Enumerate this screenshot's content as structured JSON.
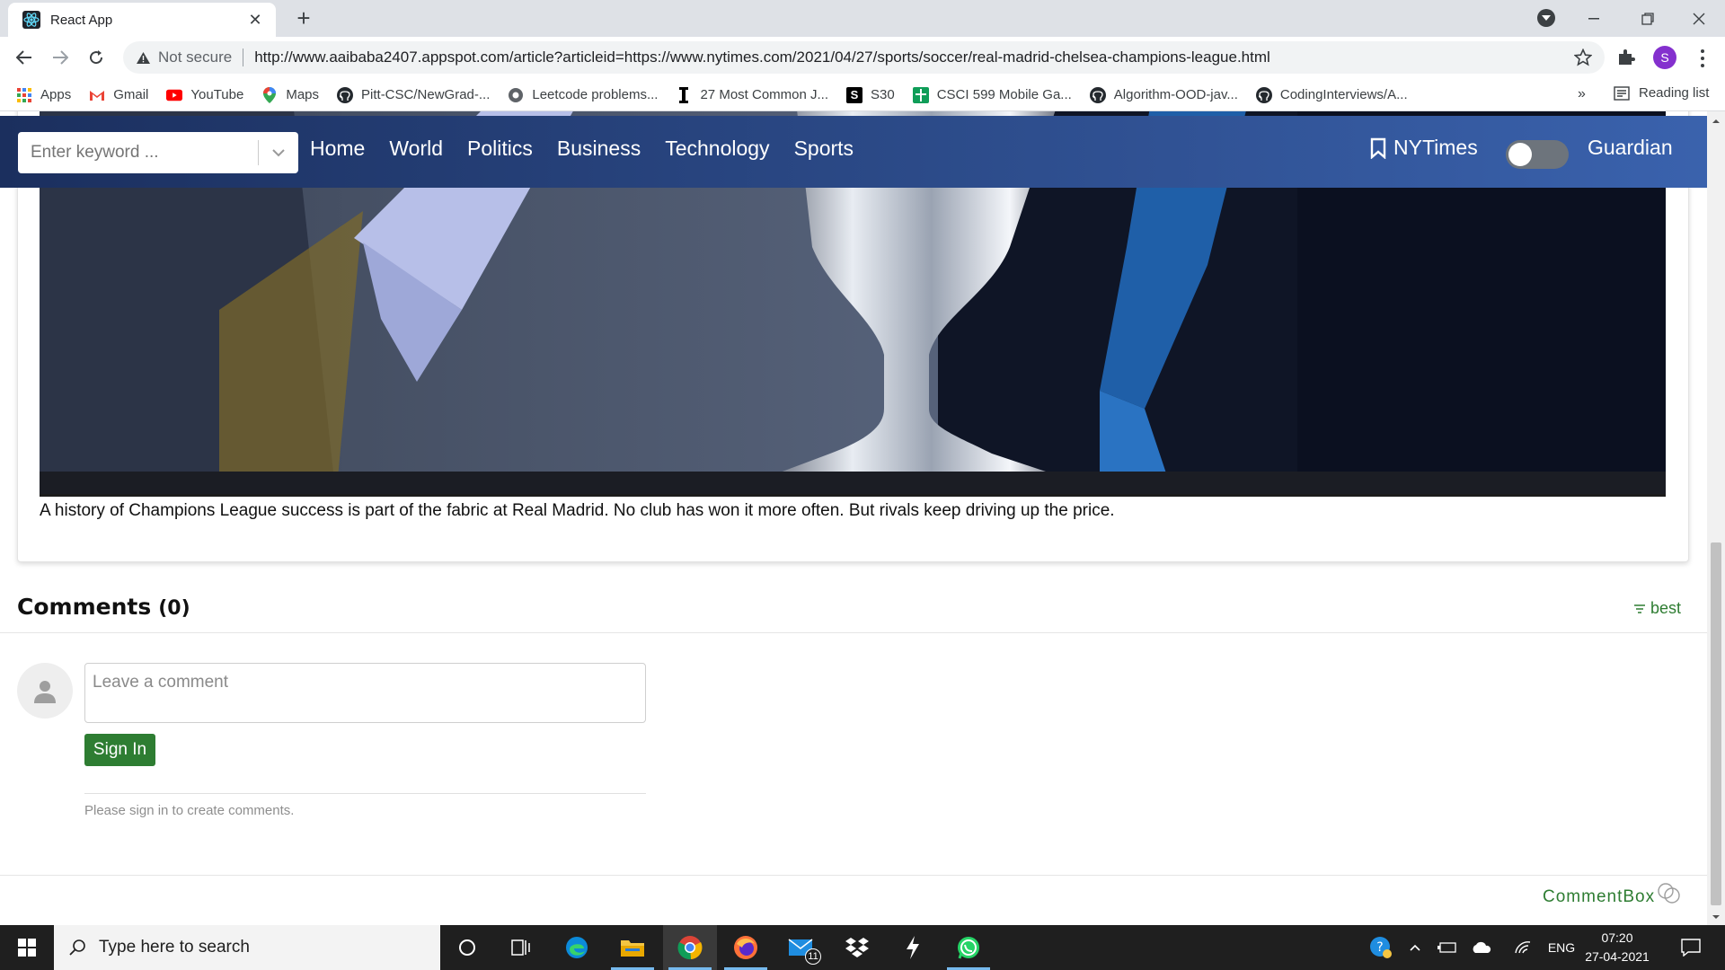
{
  "browser": {
    "tab_title": "React App",
    "security_label": "Not secure",
    "url": "http://www.aaibaba2407.appspot.com/article?articleid=https://www.nytimes.com/2021/04/27/sports/soccer/real-madrid-chelsea-champions-league.html",
    "profile_initial": "S",
    "bookmarks": [
      {
        "label": "Apps",
        "icon": "apps-grid-icon"
      },
      {
        "label": "Gmail",
        "icon": "gmail-icon"
      },
      {
        "label": "YouTube",
        "icon": "youtube-icon"
      },
      {
        "label": "Maps",
        "icon": "maps-icon"
      },
      {
        "label": "Pitt-CSC/NewGrad-...",
        "icon": "github-icon"
      },
      {
        "label": "Leetcode problems...",
        "icon": "globe-icon"
      },
      {
        "label": "27 Most Common J...",
        "icon": "indeed-icon"
      },
      {
        "label": "S30",
        "icon": "s30-icon"
      },
      {
        "label": "CSCI 599 Mobile Ga...",
        "icon": "sheets-icon"
      },
      {
        "label": "Algorithm-OOD-jav...",
        "icon": "github-icon"
      },
      {
        "label": "CodingInterviews/A...",
        "icon": "github-icon"
      }
    ],
    "more_bookmarks": "»",
    "reading_list": "Reading list"
  },
  "navbar": {
    "search_placeholder": "Enter keyword ...",
    "links": [
      "Home",
      "World",
      "Politics",
      "Business",
      "Technology",
      "Sports"
    ],
    "nytimes_label": "NYTimes",
    "guardian_label": "Guardian",
    "toggle_state": "off"
  },
  "article": {
    "caption": "A history of Champions League success is part of the fabric at Real Madrid. No club has won it more often. But rivals keep driving up the price."
  },
  "comments": {
    "title": "Comments",
    "count": "(0)",
    "sort_label": "best",
    "input_placeholder": "Leave a comment",
    "signin_label": "Sign In",
    "hint": "Please sign in to create comments.",
    "brand": "CommentBox"
  },
  "taskbar": {
    "search_placeholder": "Type here to search",
    "mail_badge": "11",
    "language": "ENG",
    "time": "07:20",
    "date": "27-04-2021"
  },
  "colors": {
    "navbar_start": "#1b2f5e",
    "navbar_end": "#3a62ad",
    "commentbox_green": "#2e7d32",
    "profile_purple": "#8430ce"
  }
}
